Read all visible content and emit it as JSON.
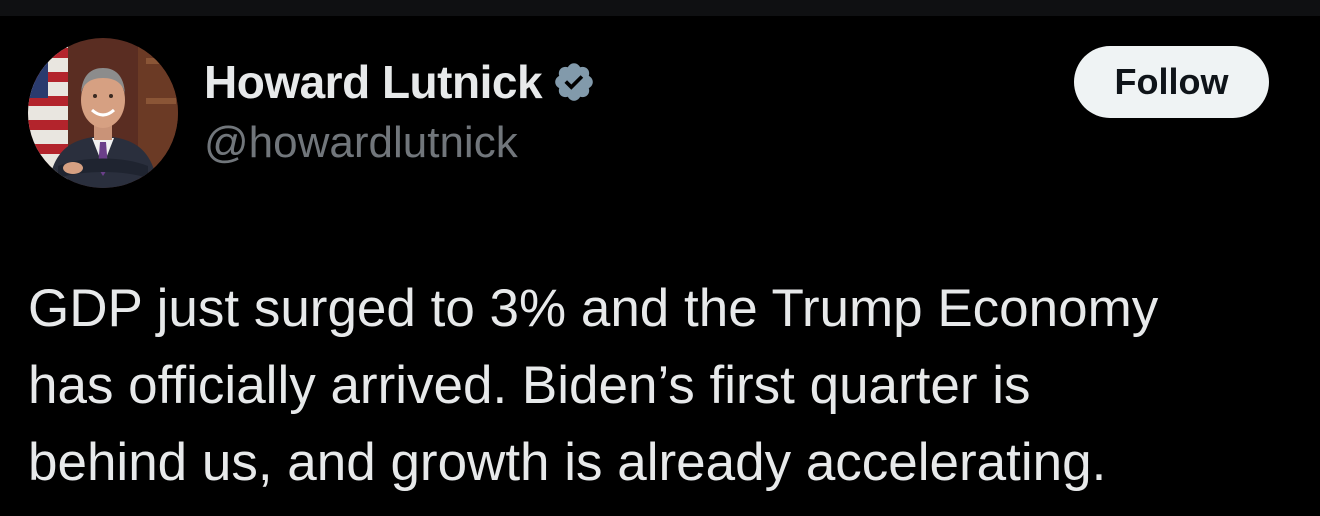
{
  "tweet": {
    "author": {
      "display_name": "Howard Lutnick",
      "handle": "@howardlutnick",
      "verified": true,
      "avatar_icon": "avatar-portrait"
    },
    "follow_label": "Follow",
    "text_lines": [
      "GDP just surged to 3% and the Trump Economy",
      "has officially arrived. Biden’s first quarter is",
      "behind us, and growth is already accelerating."
    ]
  },
  "colors": {
    "background": "#000000",
    "text_primary": "#e7e9ea",
    "text_secondary": "#71767b",
    "verified_badge": "#829aab",
    "follow_bg": "#eff3f4",
    "follow_text": "#0f1419"
  }
}
